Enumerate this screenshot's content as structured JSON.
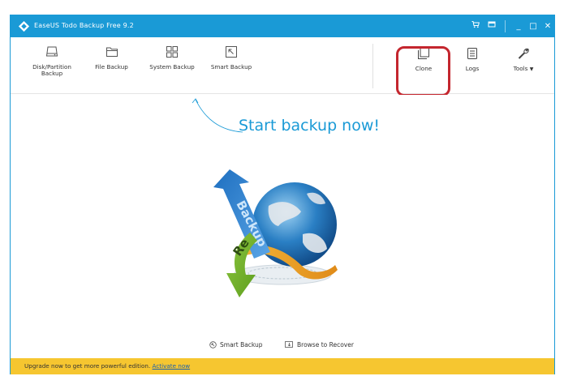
{
  "window": {
    "title": "EaseUS Todo Backup Free 9.2",
    "accent_color": "#1a9ad6",
    "controls": [
      {
        "icon": "cart-icon"
      },
      {
        "icon": "window-icon"
      },
      {
        "icon": "minimize-icon",
        "glyph": "_"
      },
      {
        "icon": "maximize-icon",
        "glyph": "□"
      },
      {
        "icon": "close-icon",
        "glyph": "✕"
      }
    ]
  },
  "toolbar": {
    "backup_tools": [
      {
        "label_line1": "Disk/Partition",
        "label_line2": "Backup",
        "icon": "disk-icon"
      },
      {
        "label_line1": "File Backup",
        "label_line2": "",
        "icon": "folder-icon"
      },
      {
        "label_line1": "System Backup",
        "label_line2": "",
        "icon": "windows-icon"
      },
      {
        "label_line1": "Smart Backup",
        "label_line2": "",
        "icon": "smart-backup-icon"
      }
    ],
    "right_tools": [
      {
        "label": "Clone",
        "icon": "clone-icon"
      },
      {
        "label": "Logs",
        "icon": "logs-icon"
      },
      {
        "label": "Tools",
        "icon": "wrench-icon",
        "dropdown": "▼"
      }
    ],
    "highlight_color": "#c4262e"
  },
  "main": {
    "headline": "Start backup now!",
    "graphic_text_backup": "Backup",
    "graphic_text_recovery": "Re"
  },
  "bottom_links": {
    "smart_backup": "Smart Backup",
    "browse_recover": "Browse to Recover"
  },
  "statusbar": {
    "message": "Upgrade now to get more powerful edition.",
    "link": "Activate now",
    "background_color": "#f6c630"
  }
}
